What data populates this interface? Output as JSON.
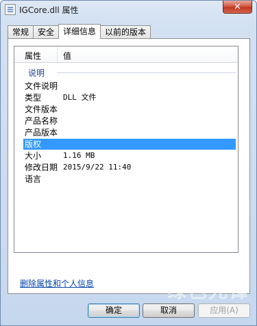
{
  "window": {
    "title": "IGCore.dll 属性",
    "close_glyph": "✕"
  },
  "tabs": [
    {
      "label": "常规",
      "active": false
    },
    {
      "label": "安全",
      "active": false
    },
    {
      "label": "详细信息",
      "active": true
    },
    {
      "label": "以前的版本",
      "active": false
    }
  ],
  "details": {
    "headers": {
      "property": "属性",
      "value": "值"
    },
    "group": "说明",
    "rows": [
      {
        "property": "文件说明",
        "value": ""
      },
      {
        "property": "类型",
        "value": "DLL 文件"
      },
      {
        "property": "文件版本",
        "value": ""
      },
      {
        "property": "产品名称",
        "value": ""
      },
      {
        "property": "产品版本",
        "value": ""
      },
      {
        "property": "版权",
        "value": "",
        "selected": true
      },
      {
        "property": "大小",
        "value": "1.16 MB"
      },
      {
        "property": "修改日期",
        "value": "2015/9/22 11:40"
      },
      {
        "property": "语言",
        "value": ""
      }
    ]
  },
  "remove_link": "删除属性和个人信息",
  "buttons": {
    "ok": "确定",
    "cancel": "取消",
    "apply": "应用(A)"
  },
  "watermark": "绿色先锋"
}
